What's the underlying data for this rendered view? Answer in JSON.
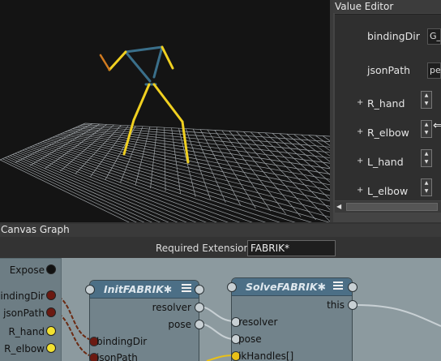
{
  "value_editor": {
    "title": "Value Editor",
    "rows": [
      {
        "label": "bindingDir",
        "value": "G_",
        "expandable": false
      },
      {
        "label": "jsonPath",
        "value": "pe",
        "expandable": false
      },
      {
        "label": "R_hand",
        "expandable": true
      },
      {
        "label": "R_elbow",
        "expandable": true
      },
      {
        "label": "L_hand",
        "expandable": true
      },
      {
        "label": "L_elbow",
        "expandable": true
      }
    ],
    "plus": "+",
    "spin_up": "▲",
    "spin_down": "▼",
    "scroll_left": "◀"
  },
  "canvas_graph": {
    "title": "Canvas Graph",
    "required_extensions_label": "Required Extensions:",
    "required_extensions_value": "FABRIK*",
    "backdrop_ports": [
      {
        "label": "Expose",
        "color": "#111111"
      },
      {
        "label": "bindingDir",
        "color": "#6b1a12"
      },
      {
        "label": "jsonPath",
        "color": "#6b1a12"
      },
      {
        "label": "R_hand",
        "color": "#f2e230"
      },
      {
        "label": "R_elbow",
        "color": "#f2e230"
      }
    ],
    "init_node": {
      "title": "InitFABRIK✱",
      "out_ports": [
        "resolver",
        "pose"
      ],
      "in_ports": [
        "bindingDir",
        "jsonPath"
      ]
    },
    "solve_node": {
      "title": "SolveFABRIK✱",
      "in_ports": [
        "resolver",
        "pose",
        "ikHandles[]"
      ],
      "out_ports": [
        "this"
      ]
    }
  },
  "colors": {
    "viewport_bg": "#141414",
    "grid": "#9fa4a8",
    "bone_yellow": "#f0d020",
    "bone_blue": "#3a6f8a",
    "node_header": "#4c6f86",
    "graph_bg": "#8c9a9f"
  }
}
